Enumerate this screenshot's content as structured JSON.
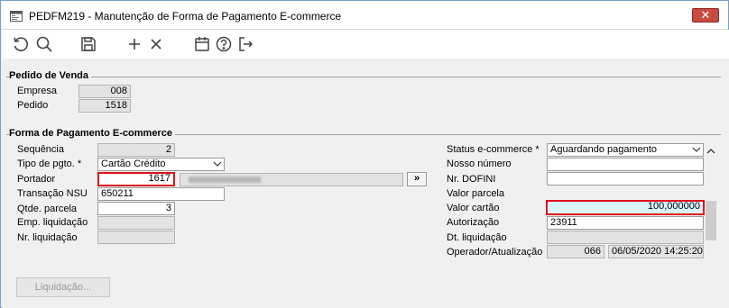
{
  "window": {
    "title": "PEDFM219 - Manutenção de Forma de Pagamento E-commerce",
    "close_glyph": "✕"
  },
  "toolbar": {
    "icons": [
      "undo-icon",
      "search-icon",
      "save-icon",
      "add-icon",
      "delete-icon",
      "calendar-icon",
      "help-icon",
      "exit-icon"
    ],
    "icon_color": "#444444"
  },
  "pedido_venda": {
    "title": "Pedido de Venda",
    "empresa_label": "Empresa",
    "empresa_value": "008",
    "pedido_label": "Pedido",
    "pedido_value": "1518"
  },
  "forma_pagamento": {
    "title": "Forma de Pagamento E-commerce",
    "sequencia_label": "Sequência",
    "sequencia_value": "2",
    "tipo_label": "Tipo de pgto. *",
    "tipo_value": "Cartão Crédito",
    "portador_label": "Portador",
    "portador_value": "1617",
    "portador_lookup_label": "»",
    "transacao_label": "Transação NSU",
    "transacao_value": "650211",
    "qtde_label": "Qtde. parcela",
    "qtde_value": "3",
    "emp_liq_label": "Emp. liquidação",
    "emp_liq_value": "",
    "nr_liq_label": "Nr. liquidação",
    "nr_liq_value": "",
    "status_label": "Status e-commerce *",
    "status_value": "Aguardando pagamento",
    "nosso_numero_label": "Nosso número",
    "nosso_numero_value": "",
    "nr_dofini_label": "Nr. DOFINI",
    "nr_dofini_value": "",
    "valor_parcela_label": "Valor parcela",
    "valor_parcela_value": "",
    "valor_cartao_label": "Valor cartão",
    "valor_cartao_value": "100,000000",
    "autorizacao_label": "Autorização",
    "autorizacao_value": "23911",
    "dt_liq_label": "Dt. liquidação",
    "dt_liq_value": "",
    "operador_label": "Operador/Atualização",
    "operador_value": "066",
    "atualizacao_value": "06/05/2020 14:25:20"
  },
  "footer": {
    "liquidacao_label": "Liquidação..."
  },
  "colors": {
    "highlight_border": "#e0101a",
    "valor_cartao_bg": "#d9f4fb",
    "close_button": "#c74b41"
  }
}
